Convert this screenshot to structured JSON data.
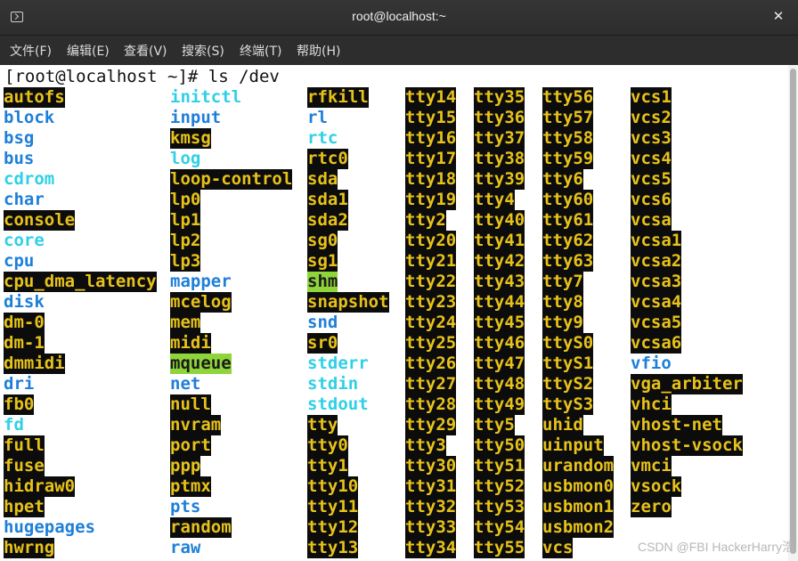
{
  "window": {
    "title": "root@localhost:~",
    "close_label": "✕"
  },
  "menu": [
    "文件(F)",
    "编辑(E)",
    "查看(V)",
    "搜索(S)",
    "终端(T)",
    "帮助(H)"
  ],
  "terminal": {
    "prompt": "[root@localhost ~]# ls /dev",
    "columns": [
      [
        [
          "autofs",
          "dev"
        ],
        [
          "block",
          "dir"
        ],
        [
          "bsg",
          "dir"
        ],
        [
          "bus",
          "dir"
        ],
        [
          "cdrom",
          "link"
        ],
        [
          "char",
          "dir"
        ],
        [
          "console",
          "dev"
        ],
        [
          "core",
          "link"
        ],
        [
          "cpu",
          "dir"
        ],
        [
          "cpu_dma_latency",
          "dev"
        ],
        [
          "disk",
          "dir"
        ],
        [
          "dm-0",
          "dev"
        ],
        [
          "dm-1",
          "dev"
        ],
        [
          "dmmidi",
          "dev"
        ],
        [
          "dri",
          "dir"
        ],
        [
          "fb0",
          "dev"
        ],
        [
          "fd",
          "link"
        ],
        [
          "full",
          "dev"
        ],
        [
          "fuse",
          "dev"
        ],
        [
          "hidraw0",
          "dev"
        ],
        [
          "hpet",
          "dev"
        ],
        [
          "hugepages",
          "dir"
        ],
        [
          "hwrng",
          "dev"
        ]
      ],
      [
        [
          "initctl",
          "link"
        ],
        [
          "input",
          "dir"
        ],
        [
          "kmsg",
          "dev"
        ],
        [
          "log",
          "link"
        ],
        [
          "loop-control",
          "dev"
        ],
        [
          "lp0",
          "dev"
        ],
        [
          "lp1",
          "dev"
        ],
        [
          "lp2",
          "dev"
        ],
        [
          "lp3",
          "dev"
        ],
        [
          "mapper",
          "dir"
        ],
        [
          "mcelog",
          "dev"
        ],
        [
          "mem",
          "dev"
        ],
        [
          "midi",
          "dev"
        ],
        [
          "mqueue",
          "sock"
        ],
        [
          "net",
          "dir"
        ],
        [
          "null",
          "dev"
        ],
        [
          "nvram",
          "dev"
        ],
        [
          "port",
          "dev"
        ],
        [
          "ppp",
          "dev"
        ],
        [
          "ptmx",
          "dev"
        ],
        [
          "pts",
          "dir"
        ],
        [
          "random",
          "dev"
        ],
        [
          "raw",
          "dir"
        ]
      ],
      [
        [
          "rfkill",
          "dev"
        ],
        [
          "rl",
          "dir"
        ],
        [
          "rtc",
          "link"
        ],
        [
          "rtc0",
          "dev"
        ],
        [
          "sda",
          "dev"
        ],
        [
          "sda1",
          "dev"
        ],
        [
          "sda2",
          "dev"
        ],
        [
          "sg0",
          "dev"
        ],
        [
          "sg1",
          "dev"
        ],
        [
          "shm",
          "sock"
        ],
        [
          "snapshot",
          "dev"
        ],
        [
          "snd",
          "dir"
        ],
        [
          "sr0",
          "dev"
        ],
        [
          "stderr",
          "link"
        ],
        [
          "stdin",
          "link"
        ],
        [
          "stdout",
          "link"
        ],
        [
          "tty",
          "dev"
        ],
        [
          "tty0",
          "dev"
        ],
        [
          "tty1",
          "dev"
        ],
        [
          "tty10",
          "dev"
        ],
        [
          "tty11",
          "dev"
        ],
        [
          "tty12",
          "dev"
        ],
        [
          "tty13",
          "dev"
        ]
      ],
      [
        [
          "tty14",
          "dev"
        ],
        [
          "tty15",
          "dev"
        ],
        [
          "tty16",
          "dev"
        ],
        [
          "tty17",
          "dev"
        ],
        [
          "tty18",
          "dev"
        ],
        [
          "tty19",
          "dev"
        ],
        [
          "tty2",
          "dev"
        ],
        [
          "tty20",
          "dev"
        ],
        [
          "tty21",
          "dev"
        ],
        [
          "tty22",
          "dev"
        ],
        [
          "tty23",
          "dev"
        ],
        [
          "tty24",
          "dev"
        ],
        [
          "tty25",
          "dev"
        ],
        [
          "tty26",
          "dev"
        ],
        [
          "tty27",
          "dev"
        ],
        [
          "tty28",
          "dev"
        ],
        [
          "tty29",
          "dev"
        ],
        [
          "tty3",
          "dev"
        ],
        [
          "tty30",
          "dev"
        ],
        [
          "tty31",
          "dev"
        ],
        [
          "tty32",
          "dev"
        ],
        [
          "tty33",
          "dev"
        ],
        [
          "tty34",
          "dev"
        ]
      ],
      [
        [
          "tty35",
          "dev"
        ],
        [
          "tty36",
          "dev"
        ],
        [
          "tty37",
          "dev"
        ],
        [
          "tty38",
          "dev"
        ],
        [
          "tty39",
          "dev"
        ],
        [
          "tty4",
          "dev"
        ],
        [
          "tty40",
          "dev"
        ],
        [
          "tty41",
          "dev"
        ],
        [
          "tty42",
          "dev"
        ],
        [
          "tty43",
          "dev"
        ],
        [
          "tty44",
          "dev"
        ],
        [
          "tty45",
          "dev"
        ],
        [
          "tty46",
          "dev"
        ],
        [
          "tty47",
          "dev"
        ],
        [
          "tty48",
          "dev"
        ],
        [
          "tty49",
          "dev"
        ],
        [
          "tty5",
          "dev"
        ],
        [
          "tty50",
          "dev"
        ],
        [
          "tty51",
          "dev"
        ],
        [
          "tty52",
          "dev"
        ],
        [
          "tty53",
          "dev"
        ],
        [
          "tty54",
          "dev"
        ],
        [
          "tty55",
          "dev"
        ]
      ],
      [
        [
          "tty56",
          "dev"
        ],
        [
          "tty57",
          "dev"
        ],
        [
          "tty58",
          "dev"
        ],
        [
          "tty59",
          "dev"
        ],
        [
          "tty6",
          "dev"
        ],
        [
          "tty60",
          "dev"
        ],
        [
          "tty61",
          "dev"
        ],
        [
          "tty62",
          "dev"
        ],
        [
          "tty63",
          "dev"
        ],
        [
          "tty7",
          "dev"
        ],
        [
          "tty8",
          "dev"
        ],
        [
          "tty9",
          "dev"
        ],
        [
          "ttyS0",
          "dev"
        ],
        [
          "ttyS1",
          "dev"
        ],
        [
          "ttyS2",
          "dev"
        ],
        [
          "ttyS3",
          "dev"
        ],
        [
          "uhid",
          "dev"
        ],
        [
          "uinput",
          "dev"
        ],
        [
          "urandom",
          "dev"
        ],
        [
          "usbmon0",
          "dev"
        ],
        [
          "usbmon1",
          "dev"
        ],
        [
          "usbmon2",
          "dev"
        ],
        [
          "vcs",
          "dev"
        ]
      ],
      [
        [
          "vcs1",
          "dev"
        ],
        [
          "vcs2",
          "dev"
        ],
        [
          "vcs3",
          "dev"
        ],
        [
          "vcs4",
          "dev"
        ],
        [
          "vcs5",
          "dev"
        ],
        [
          "vcs6",
          "dev"
        ],
        [
          "vcsa",
          "dev"
        ],
        [
          "vcsa1",
          "dev"
        ],
        [
          "vcsa2",
          "dev"
        ],
        [
          "vcsa3",
          "dev"
        ],
        [
          "vcsa4",
          "dev"
        ],
        [
          "vcsa5",
          "dev"
        ],
        [
          "vcsa6",
          "dev"
        ],
        [
          "vfio",
          "dir"
        ],
        [
          "vga_arbiter",
          "dev"
        ],
        [
          "vhci",
          "dev"
        ],
        [
          "vhost-net",
          "dev"
        ],
        [
          "vhost-vsock",
          "dev"
        ],
        [
          "vmci",
          "dev"
        ],
        [
          "vsock",
          "dev"
        ],
        [
          "zero",
          "dev"
        ]
      ]
    ]
  },
  "watermark": "CSDN @FBI HackerHarry浩",
  "colors": {
    "dir": "#1e7fd8",
    "link": "#2fd0e6",
    "dev_fg": "#e7c21a",
    "dev_bg": "#0c0c0c",
    "sock_bg": "#8fd43a"
  },
  "icons": {
    "terminal": "terminal-icon",
    "close": "close-icon"
  }
}
